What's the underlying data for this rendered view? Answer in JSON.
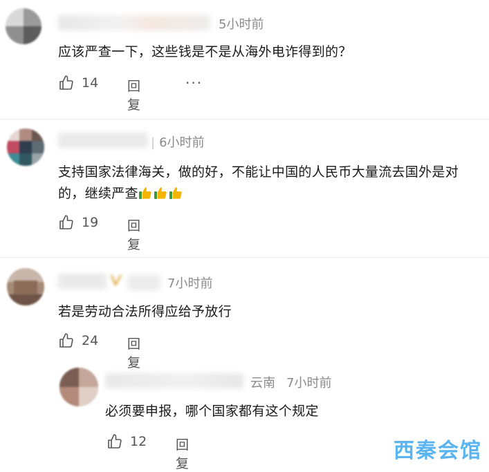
{
  "comments": [
    {
      "time": "5小时前",
      "text": "应该严查一下，这些钱是不是从海外电诈得到的？",
      "likes": "14",
      "reply_label": "回复",
      "more": "···"
    },
    {
      "time": "6小时前",
      "text": "支持国家法律海关，做的好，不能让中国的人民币大量流去国外是对的，继续严查",
      "likes": "19",
      "reply_label": "回复"
    },
    {
      "time": "7小时前",
      "text": "若是劳动合法所得应给予放行",
      "likes": "24",
      "reply_label": "回复"
    }
  ],
  "reply": {
    "location": "云南",
    "time": "7小时前",
    "text": "必须要申报，哪个国家都有这个规定",
    "likes": "12",
    "reply_label": "回复"
  },
  "watermark": "西秦会馆",
  "colors": {
    "meta": "#8a8a8a",
    "text": "#1a1a1a",
    "action": "#555555",
    "watermark": "#5ab4f0"
  }
}
